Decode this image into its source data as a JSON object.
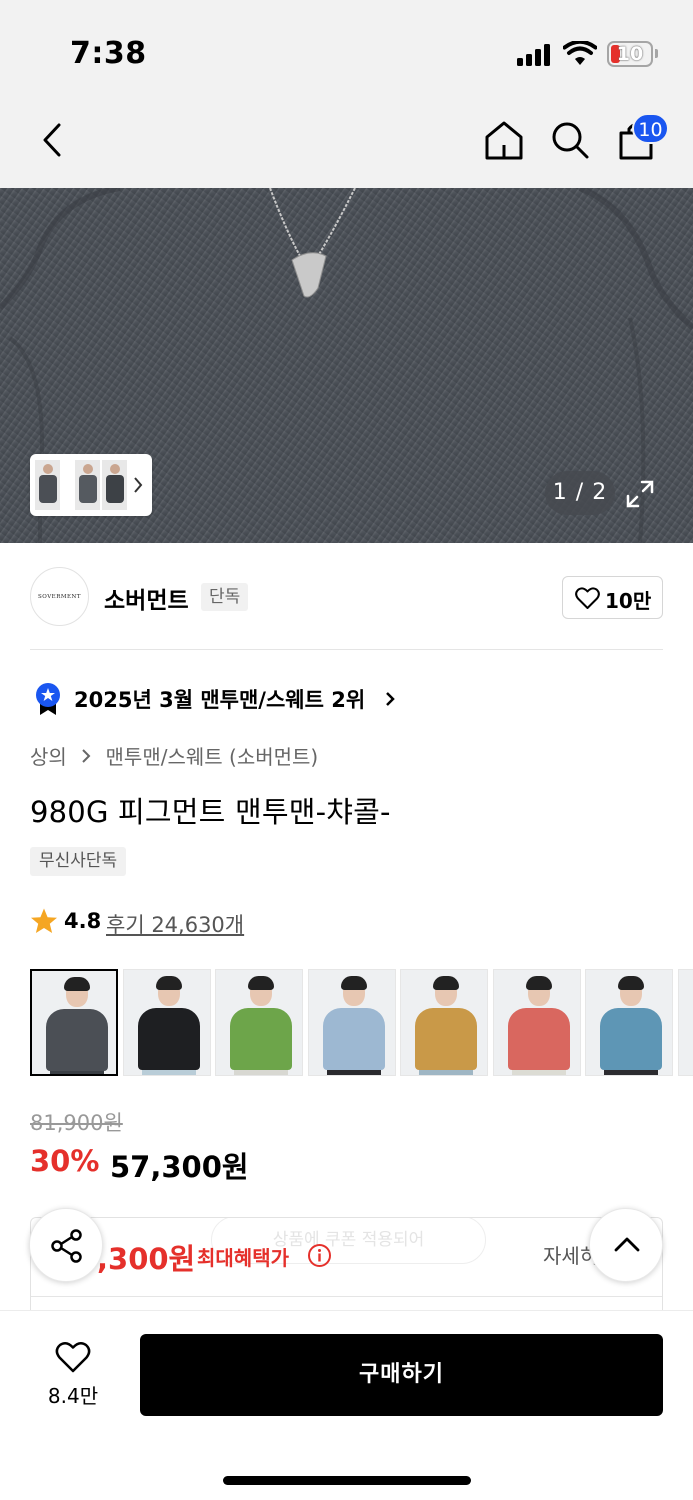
{
  "status_bar": {
    "time": "7:38",
    "battery": "10"
  },
  "nav": {
    "cart_count": "10"
  },
  "gallery": {
    "counter": "1 / 2"
  },
  "brand": {
    "logo_text": "SOVERMENT",
    "name": "소버먼트",
    "tag": "단독",
    "likes": "10만"
  },
  "ranking": {
    "text": "2025년 3월 맨투맨/스웨트 2위"
  },
  "breadcrumb": {
    "category": "상의",
    "subcategory": "맨투맨/스웨트 (소버먼트)"
  },
  "product": {
    "title": "980G 피그먼트 맨투맨-챠콜-",
    "badge": "무신사단독",
    "rating": "4.8",
    "reviews": "후기 24,630개"
  },
  "colors": [
    {
      "name": "charcoal",
      "hex": "#4b4f55",
      "pants": "#3a3f45"
    },
    {
      "name": "black",
      "hex": "#1e1f22",
      "pants": "#b9cdd8"
    },
    {
      "name": "green",
      "hex": "#6da54a",
      "pants": "#d8d8d2"
    },
    {
      "name": "sky-blue",
      "hex": "#9db8d2",
      "pants": "#2a2a2e"
    },
    {
      "name": "mustard",
      "hex": "#c99948",
      "pants": "#9fb6c4"
    },
    {
      "name": "coral",
      "hex": "#d9675f",
      "pants": "#dcdcd4"
    },
    {
      "name": "blue",
      "hex": "#5e96b5",
      "pants": "#2c2c30"
    },
    {
      "name": "beige",
      "hex": "#c9b48e",
      "pants": "#2c2c30"
    }
  ],
  "price": {
    "original": "81,900원",
    "discount": "30%",
    "sale": "57,300원"
  },
  "benefit": {
    "ghost_text": "상품에 쿠폰 적용되어",
    "price": ",300원",
    "label": "최대혜택가",
    "detail": "자세히"
  },
  "bottom": {
    "wish_count": "8.4만",
    "buy_label": "구매하기"
  },
  "theme": {
    "accent_red": "#e5302b",
    "badge_blue": "#1a56f0"
  }
}
